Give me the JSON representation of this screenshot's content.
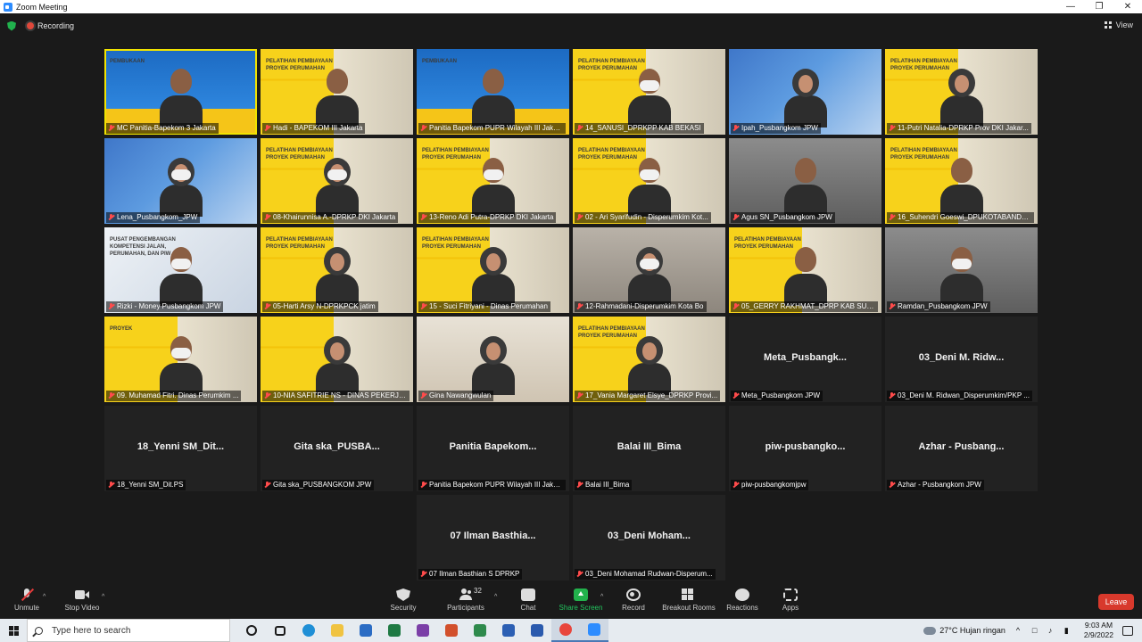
{
  "window": {
    "title": "Zoom Meeting"
  },
  "status": {
    "recording_label": "Recording",
    "view_label": "View"
  },
  "tiles": [
    [
      {
        "label": "MC Panitia-Bapekom 3 Jakarta",
        "bg": "opening",
        "poster": "PEMBUKAAN",
        "speaking": true
      },
      {
        "label": "Hadi - BAPEKOM III Jakarta",
        "bg": "yellow",
        "poster": "PELATIHAN PEMBIAYAAN PROYEK PERUMAHAN"
      },
      {
        "label": "Panitia Bapekom PUPR Wilayah III Jakarta",
        "bg": "opening",
        "poster": "PEMBUKAAN"
      },
      {
        "label": "14_SANUSI_DPRKPP KAB BEKASI",
        "bg": "yellow",
        "poster": "PELATIHAN PEMBIAYAAN PROYEK PERUMAHAN"
      },
      {
        "label": "Ipah_Pusbangkom JPW",
        "bg": "blue",
        "poster": ""
      },
      {
        "label": "11-Putri Natalia-DPRKP Prov DKI Jakar...",
        "bg": "yellow",
        "poster": "PELATIHAN PEMBIAYAAN PROYEK PERUMAHAN"
      }
    ],
    [
      {
        "label": "Lena_Pusbangkom_JPW",
        "bg": "blue",
        "poster": ""
      },
      {
        "label": "08-Khairunnisa A.-DPRKP DKI Jakarta",
        "bg": "yellow",
        "poster": "PELATIHAN PEMBIAYAAN PROYEK PERUMAHAN"
      },
      {
        "label": "13-Reno Adi Putra-DPRKP DKI Jakarta",
        "bg": "yellow",
        "poster": "PELATIHAN PEMBIAYAAN PROYEK PERUMAHAN"
      },
      {
        "label": "02 - Ari Syarifudin - Disperumkim Kot...",
        "bg": "yellow",
        "poster": "PELATIHAN PEMBIAYAAN PROYEK PERUMAHAN"
      },
      {
        "label": "Agus SN_Pusbangkom JPW",
        "bg": "room",
        "poster": ""
      },
      {
        "label": "16_Suhendri Goeswi_DPUKOTABANDA...",
        "bg": "yellow",
        "poster": "PELATIHAN PEMBIAYAAN PROYEK PERUMAHAN"
      }
    ],
    [
      {
        "label": "Rizki - Money Pusbangkom JPW",
        "bg": "light",
        "poster": "PUSAT PENGEMBANGAN KOMPETENSI JALAN, PERUMAHAN, DAN PIW"
      },
      {
        "label": "05-Harti Arsy N-DPRKPCK jatim",
        "bg": "yellow",
        "poster": "PELATIHAN PEMBIAYAAN PROYEK PERUMAHAN"
      },
      {
        "label": "15 - Suci Fitriyani - Dinas Perumahan",
        "bg": "yellow",
        "poster": "PELATIHAN PEMBIAYAAN PROYEK PERUMAHAN"
      },
      {
        "label": "12-Rahmadani-Disperumkim Kota Bo",
        "bg": "room2",
        "poster": ""
      },
      {
        "label": "05_GERRY RAKHMAT_DPRP KAB SUBA...",
        "bg": "yellow",
        "poster": "PELATIHAN PEMBIAYAAN PROYEK PERUMAHAN"
      },
      {
        "label": "Ramdan_Pusbangkom JPW",
        "bg": "room",
        "poster": ""
      }
    ],
    [
      {
        "label": "09. Muhamad Fitri. Dinas Perumkim ...",
        "bg": "yellow",
        "poster": "PROYEK"
      },
      {
        "label": "10-NIA SAFITRIE NS - DINAS PEKERJA...",
        "bg": "yellow",
        "poster": ""
      },
      {
        "label": "Gina Nawangwulan",
        "bg": "beige",
        "poster": ""
      },
      {
        "label": "17_Vania Margaret Elsye_DPRKP Provi...",
        "bg": "yellow",
        "poster": "PELATIHAN PEMBIAYAAN PROYEK PERUMAHAN"
      },
      {
        "label": "Meta_Pusbangkom JPW",
        "bg": "dark",
        "name": "Meta_Pusbangk..."
      },
      {
        "label": "03_Deni M. Ridwan_Disperumkim/PKP ...",
        "bg": "dark",
        "name": "03_Deni M. Ridw..."
      }
    ],
    [
      {
        "label": "18_Yenni SM_Dit.PS",
        "bg": "dark",
        "name": "18_Yenni SM_Dit..."
      },
      {
        "label": "Gita ska_PUSBANGKOM JPW",
        "bg": "dark",
        "name": "Gita ska_PUSBA..."
      },
      {
        "label": "Panitia Bapekom PUPR Wilayah III Jaka...",
        "bg": "dark",
        "name": "Panitia Bapekom..."
      },
      {
        "label": "Balai III_Bima",
        "bg": "dark",
        "name": "Balai III_Bima"
      },
      {
        "label": "piw-pusbangkomjpw",
        "bg": "dark",
        "name": "piw-pusbangko..."
      },
      {
        "label": "Azhar - Pusbangkom JPW",
        "bg": "dark",
        "name": "Azhar - Pusbang..."
      }
    ],
    [
      {
        "label": "07 Ilman Basthian S DPRKP",
        "bg": "dark",
        "name": "07 Ilman Basthia..."
      },
      {
        "label": "03_Deni Mohamad Rudwan-Disperum...",
        "bg": "dark",
        "name": "03_Deni Moham..."
      }
    ]
  ],
  "toolbar": {
    "unmute": "Unmute",
    "stop_video": "Stop Video",
    "security": "Security",
    "participants": "Participants",
    "participants_count": "32",
    "chat": "Chat",
    "share_screen": "Share Screen",
    "record": "Record",
    "breakout_rooms": "Breakout Rooms",
    "reactions": "Reactions",
    "apps": "Apps",
    "leave": "Leave"
  },
  "taskbar": {
    "search_placeholder": "Type here to search",
    "weather": "27°C  Hujan ringan",
    "time": "9:03 AM",
    "date": "2/9/2022",
    "apps": [
      {
        "name": "cortana-icon",
        "color": "#1b1b1b"
      },
      {
        "name": "task-view-icon",
        "color": "#1b1b1b"
      },
      {
        "name": "edge-icon",
        "color": "#1f8fd6"
      },
      {
        "name": "file-explorer-icon",
        "color": "#f0c341"
      },
      {
        "name": "store-icon",
        "color": "#2b6cc4"
      },
      {
        "name": "excel-icon",
        "color": "#1f7a44"
      },
      {
        "name": "onenote-icon",
        "color": "#7b3fa7"
      },
      {
        "name": "powerpoint-icon",
        "color": "#d2502c"
      },
      {
        "name": "project-icon",
        "color": "#2e8a4c"
      },
      {
        "name": "visio-icon",
        "color": "#2c5fb3"
      },
      {
        "name": "word-icon",
        "color": "#2a5aad"
      },
      {
        "name": "chrome-icon",
        "color": "#e8453c"
      },
      {
        "name": "zoom-icon",
        "color": "#2d8cff"
      }
    ]
  }
}
